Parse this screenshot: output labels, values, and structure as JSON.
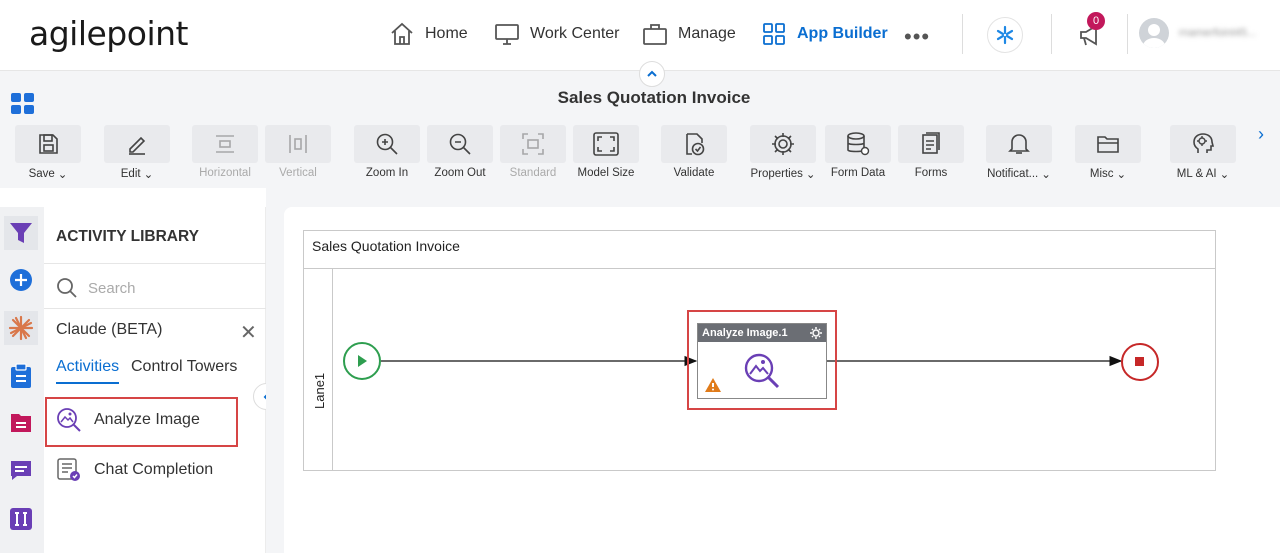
{
  "brand": {
    "logo_text": "agilepoint"
  },
  "nav": {
    "items": [
      {
        "label": "Home",
        "icon": "home-icon"
      },
      {
        "label": "Work Center",
        "icon": "monitor-icon"
      },
      {
        "label": "Manage",
        "icon": "briefcase-icon"
      },
      {
        "label": "App Builder",
        "icon": "grid-icon",
        "active": true
      }
    ],
    "more": "•••",
    "notification_count": "0",
    "username": "rnamerfoint45..."
  },
  "page": {
    "title": "Sales Quotation Invoice"
  },
  "toolbar": {
    "items": [
      {
        "label": "Save",
        "icon": "save-icon",
        "dropdown": true
      },
      {
        "label": "Edit",
        "icon": "pencil-icon",
        "dropdown": true
      },
      {
        "label": "Horizontal",
        "icon": "horizontal-icon",
        "disabled": true
      },
      {
        "label": "Vertical",
        "icon": "vertical-icon",
        "disabled": true
      },
      {
        "label": "Zoom In",
        "icon": "zoom-in-icon"
      },
      {
        "label": "Zoom Out",
        "icon": "zoom-out-icon"
      },
      {
        "label": "Standard",
        "icon": "standard-icon",
        "disabled": true
      },
      {
        "label": "Model Size",
        "icon": "model-size-icon"
      },
      {
        "label": "Validate",
        "icon": "validate-icon"
      },
      {
        "label": "Properties",
        "icon": "gear-icon",
        "dropdown": true
      },
      {
        "label": "Form Data",
        "icon": "database-icon"
      },
      {
        "label": "Forms",
        "icon": "forms-icon"
      },
      {
        "label": "Notificat...",
        "icon": "bell-icon",
        "dropdown": true
      },
      {
        "label": "Misc",
        "icon": "folder-icon",
        "dropdown": true
      },
      {
        "label": "ML & AI",
        "icon": "ai-head-icon",
        "dropdown": true
      }
    ]
  },
  "library": {
    "title": "ACTIVITY LIBRARY",
    "search_placeholder": "Search",
    "group": "Claude (BETA)",
    "tabs": [
      "Activities",
      "Control Towers"
    ],
    "items": [
      {
        "label": "Analyze Image",
        "icon": "analyze-image-icon"
      },
      {
        "label": "Chat Completion",
        "icon": "chat-completion-icon"
      }
    ]
  },
  "process": {
    "pool_title": "Sales Quotation Invoice",
    "lane": "Lane1",
    "activity_label": "Analyze Image.1"
  },
  "colors": {
    "accent": "#0a6ed1",
    "highlight": "#d64545",
    "start": "#2e9e4f",
    "end": "#c62828"
  }
}
